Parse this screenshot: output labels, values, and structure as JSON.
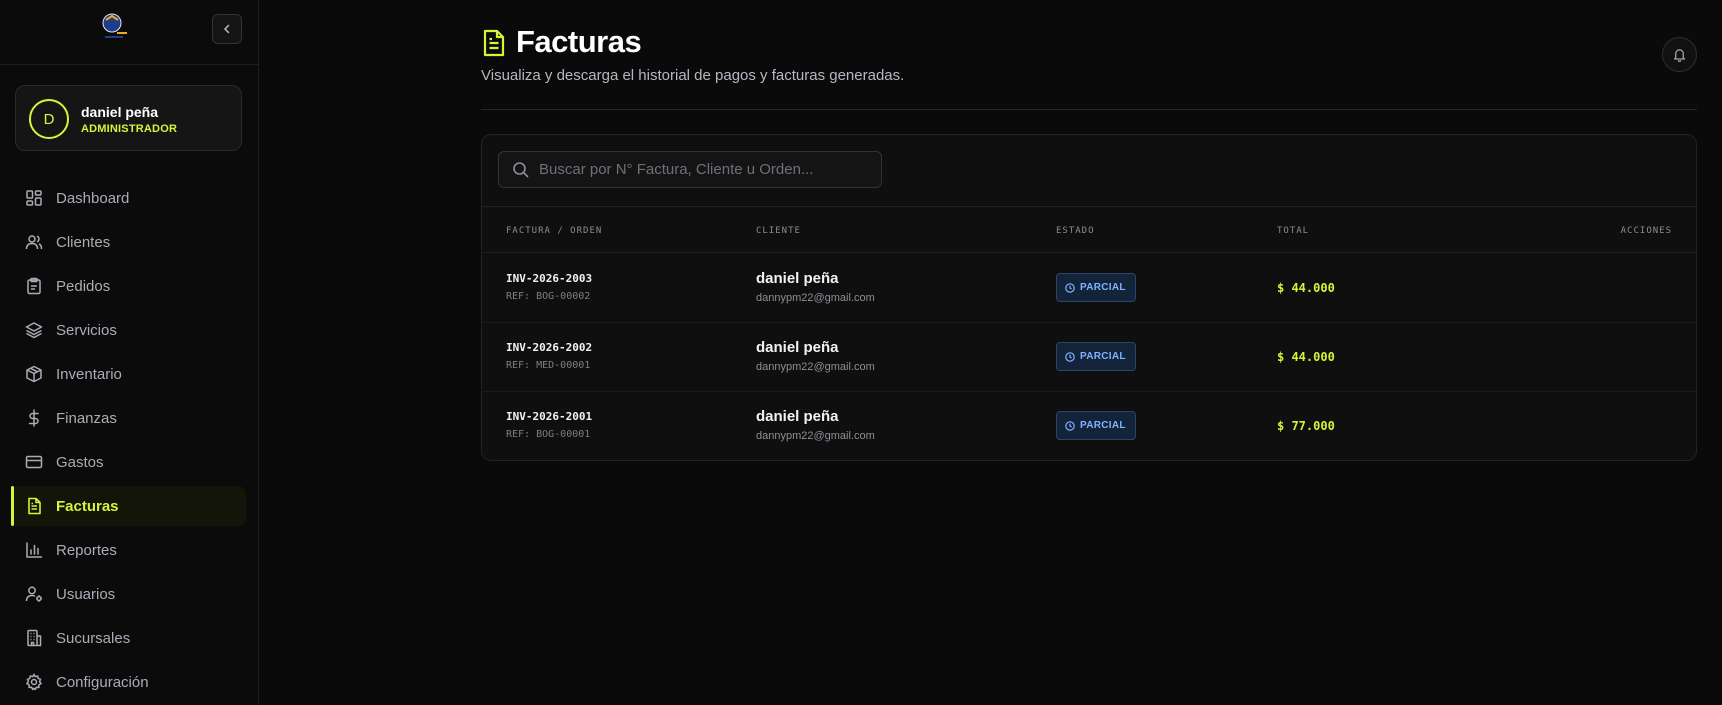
{
  "colors": {
    "accent": "#d4f53a",
    "badge_text": "#7fb2ff",
    "badge_bg": "#13233a"
  },
  "user": {
    "initial": "D",
    "name": "daniel peña",
    "role": "ADMINISTRADOR"
  },
  "nav": [
    {
      "label": "Dashboard",
      "icon": "dashboard-icon"
    },
    {
      "label": "Clientes",
      "icon": "users-icon"
    },
    {
      "label": "Pedidos",
      "icon": "clipboard-icon"
    },
    {
      "label": "Servicios",
      "icon": "layers-icon"
    },
    {
      "label": "Inventario",
      "icon": "box-icon"
    },
    {
      "label": "Finanzas",
      "icon": "dollar-icon"
    },
    {
      "label": "Gastos",
      "icon": "credit-card-icon"
    },
    {
      "label": "Facturas",
      "icon": "file-text-icon",
      "active": true
    },
    {
      "label": "Reportes",
      "icon": "bar-chart-icon"
    },
    {
      "label": "Usuarios",
      "icon": "user-cog-icon"
    },
    {
      "label": "Sucursales",
      "icon": "building-icon"
    },
    {
      "label": "Configuración",
      "icon": "gear-icon"
    }
  ],
  "page": {
    "title": "Facturas",
    "subtitle": "Visualiza y descarga el historial de pagos y facturas generadas."
  },
  "search": {
    "placeholder": "Buscar por N° Factura, Cliente u Orden...",
    "value": ""
  },
  "table": {
    "columns": [
      "FACTURA / ORDEN",
      "CLIENTE",
      "ESTADO",
      "TOTAL",
      "ACCIONES"
    ],
    "rows": [
      {
        "invoice": "INV-2026-2003",
        "ref": "REF: BOG-00002",
        "client": "daniel peña",
        "email": "dannypm22@gmail.com",
        "status": "PARCIAL",
        "total": "$ 44.000"
      },
      {
        "invoice": "INV-2026-2002",
        "ref": "REF: MED-00001",
        "client": "daniel peña",
        "email": "dannypm22@gmail.com",
        "status": "PARCIAL",
        "total": "$ 44.000"
      },
      {
        "invoice": "INV-2026-2001",
        "ref": "REF: BOG-00001",
        "client": "daniel peña",
        "email": "dannypm22@gmail.com",
        "status": "PARCIAL",
        "total": "$ 77.000"
      }
    ]
  }
}
